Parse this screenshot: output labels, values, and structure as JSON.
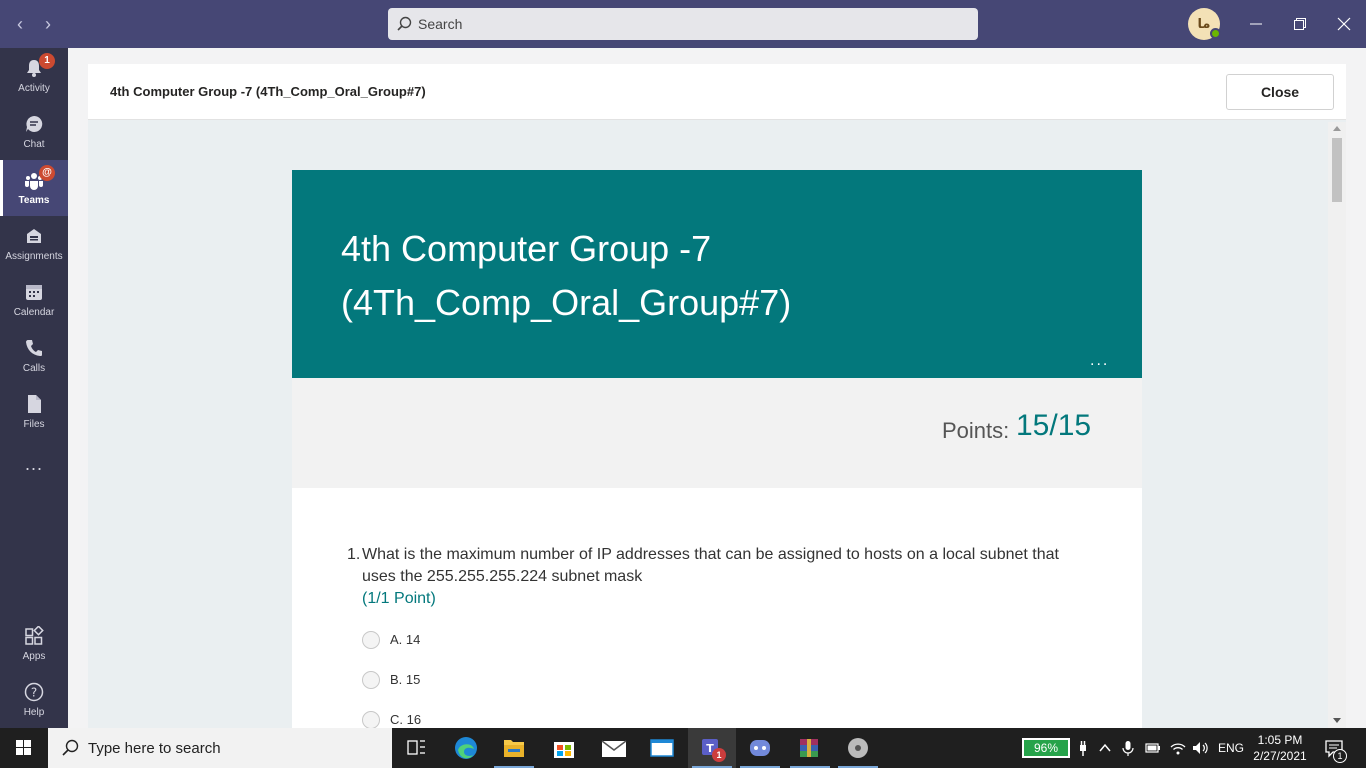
{
  "titlebar": {
    "search_placeholder": "Search",
    "avatar_initials": "ما"
  },
  "rail": {
    "items": [
      {
        "label": "Activity",
        "badge": "1"
      },
      {
        "label": "Chat"
      },
      {
        "label": "Teams",
        "badge": "@"
      },
      {
        "label": "Assignments"
      },
      {
        "label": "Calendar"
      },
      {
        "label": "Calls"
      },
      {
        "label": "Files"
      },
      {
        "label": "Apps"
      },
      {
        "label": "Help"
      }
    ],
    "more": "..."
  },
  "dialog": {
    "title": "4th Computer Group -7 (4Th_Comp_Oral_Group#7)",
    "close_label": "Close"
  },
  "form": {
    "banner_title": "4th Computer Group -7 (4Th_Comp_Oral_Group#7)",
    "more": "...",
    "points_label": "Points:",
    "points_value": "15/15",
    "questions": [
      {
        "number": "1.",
        "text": "What is the maximum number of IP addresses that can be assigned to hosts on a local subnet that uses the 255.255.255.224 subnet mask",
        "points": "(1/1 Point)",
        "options": [
          "A. 14",
          "B. 15",
          "C. 16"
        ]
      }
    ]
  },
  "taskbar": {
    "search_placeholder": "Type here to search",
    "battery": "96%",
    "language": "ENG",
    "time": "1:05 PM",
    "date": "2/27/2021",
    "teams_badge": "1",
    "notification_count": "1"
  },
  "colors": {
    "accent_teal": "#03787c",
    "teams_purple": "#464775",
    "rail_bg": "#33344a"
  }
}
